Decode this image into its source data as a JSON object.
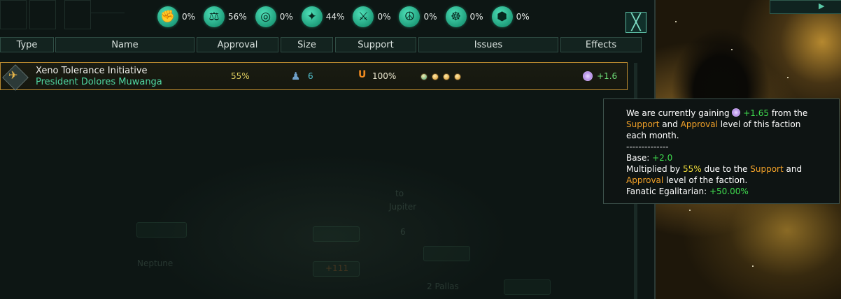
{
  "ethics": [
    {
      "icon": "fist-icon",
      "glyph": "✊",
      "pct": "0%"
    },
    {
      "icon": "scales-icon",
      "glyph": "⚖",
      "pct": "56%"
    },
    {
      "icon": "globe-icon",
      "glyph": "◎",
      "pct": "0%"
    },
    {
      "icon": "star-icon",
      "glyph": "✦",
      "pct": "44%"
    },
    {
      "icon": "swords-icon",
      "glyph": "⚔",
      "pct": "0%"
    },
    {
      "icon": "peace-icon",
      "glyph": "☮",
      "pct": "0%"
    },
    {
      "icon": "meditate-icon",
      "glyph": "☸",
      "pct": "0%"
    },
    {
      "icon": "hive-icon",
      "glyph": "⬢",
      "pct": "0%"
    }
  ],
  "close_glyph": "╳",
  "headers": {
    "type": "Type",
    "name": "Name",
    "approval": "Approval",
    "size": "Size",
    "support": "Support",
    "issues": "Issues",
    "effects": "Effects"
  },
  "faction": {
    "name": "Xeno Tolerance Initiative",
    "leader": "President Dolores Muwanga",
    "approval": "55%",
    "size": "6",
    "support": "100%",
    "effect": "+1.6",
    "issue_colors": [
      "#3aa886",
      "#d8962a",
      "#d8962a",
      "#d8962a"
    ]
  },
  "tooltip": {
    "line1_a": "We are currently gaining ",
    "line1_val": "+1.65",
    "line1_b": " from the",
    "line2_support": "Support",
    "line2_and": " and ",
    "line2_approval": "Approval",
    "line2_rest": " level of this faction",
    "line3": "each month.",
    "divider": "--------------",
    "base_label": "Base: ",
    "base_val": "+2.0",
    "mult_a": "Multiplied by ",
    "mult_val": "55%",
    "mult_b": " due to the ",
    "mult_support": "Support",
    "mult_and": " and",
    "mult_approval": "Approval",
    "mult_rest": " level of the faction.",
    "fanatic_label": "Fanatic Egalitarian: ",
    "fanatic_val": "+50.00%"
  },
  "map": {
    "to_jupiter_1": "to",
    "to_jupiter_2": "Jupiter",
    "neptune": "Neptune",
    "pallas": "2 Pallas",
    "val_111": "+111",
    "count_6": "6"
  }
}
